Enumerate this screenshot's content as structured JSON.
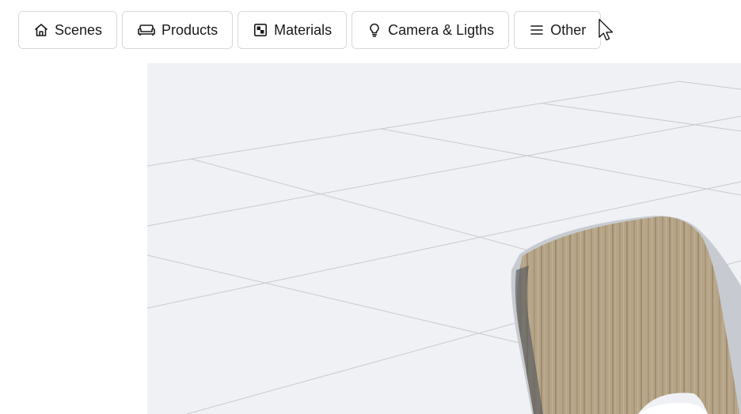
{
  "toolbar": {
    "buttons": [
      {
        "label": "Scenes",
        "icon": "house-icon"
      },
      {
        "label": "Products",
        "icon": "sofa-icon"
      },
      {
        "label": "Materials",
        "icon": "material-swatch-icon"
      },
      {
        "label": "Camera & Ligths",
        "icon": "lightbulb-icon"
      },
      {
        "label": "Other",
        "icon": "menu-icon"
      }
    ]
  },
  "viewport": {
    "background": "#f0f1f5",
    "grid_color": "#c9cacf",
    "object": "chair"
  },
  "colors": {
    "border": "#d9d9d9",
    "text": "#1a1a1a",
    "wood": "#b4a386"
  }
}
